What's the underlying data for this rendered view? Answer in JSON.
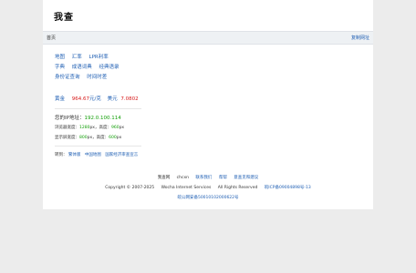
{
  "logo": "我查",
  "nav": {
    "home": "首页",
    "copy_url": "复制网址"
  },
  "links_row1": [
    "地图",
    "汇率",
    "LPR利率"
  ],
  "links_row2": [
    "字典",
    "成语词典",
    "经典语录"
  ],
  "links_row3": [
    "身份证查询",
    "时间时差"
  ],
  "prices": {
    "gold_label": "黄金",
    "gold_value": "964.67",
    "gold_unit": "元/克",
    "usd_label": "美元",
    "usd_value": "7.0802"
  },
  "ip": {
    "label": "您的IP地址：",
    "value": "192.0.100.114"
  },
  "browser": {
    "label": "浏览器宽度：",
    "width": "1280",
    "unit1": "px，高度：",
    "height": "960",
    "unit2": "px"
  },
  "screen": {
    "label": "显示屏宽度：",
    "width": "800",
    "unit1": "px，高度：",
    "height": "600",
    "unit2": "px"
  },
  "switch": {
    "label": "转到：",
    "links": [
      "繁体版",
      "中国地图",
      "国家经济审查宣言"
    ]
  },
  "footer": {
    "line1": [
      "我查网",
      "chcxn",
      "联系我们",
      "帮帮",
      "意查见和建议"
    ],
    "line2_prefix": "Copyright © 2007-2025",
    "line2_company": "Wocha Internet Services",
    "line2_rights": "All Rights Reserved",
    "line2_icp": "皖ICP备09004898号-13",
    "line3": "皖公网安备50010102000622号"
  },
  "colors": {
    "link": "#1e5eb3",
    "price": "#d71a1a",
    "value_green": "#14a00a"
  }
}
